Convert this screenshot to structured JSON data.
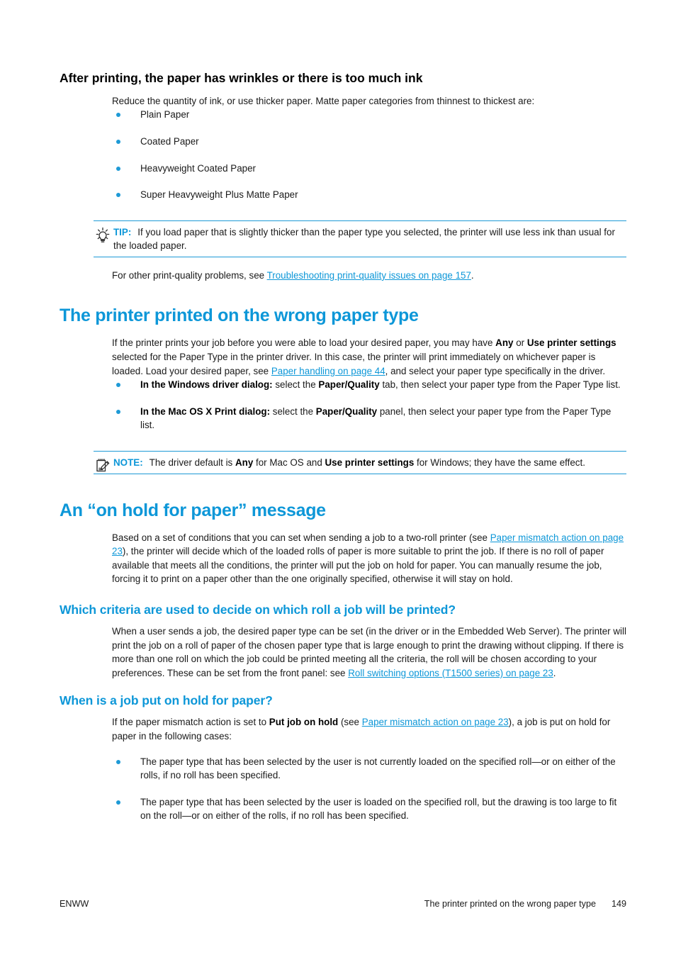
{
  "document": {
    "accent_color": "#0d97d8",
    "bullet_color": "#1e9ad6",
    "text_color": "#1a1a1a"
  },
  "section1": {
    "heading": "After printing, the paper has wrinkles or there is too much ink",
    "intro": "Reduce the quantity of ink, or use thicker paper. Matte paper categories from thinnest to thickest are:",
    "paper_types": [
      "Plain Paper",
      "Coated Paper",
      "Heavyweight Coated Paper",
      "Super Heavyweight Plus Matte Paper"
    ],
    "tip": {
      "icon": "lightbulb-icon",
      "label": "TIP:",
      "text": "If you load paper that is slightly thicker than the paper type you selected, the printer will use less ink than usual for the loaded paper."
    },
    "closing_prefix": "For other print-quality problems, see ",
    "closing_link": "Troubleshooting print-quality issues on page 157",
    "closing_suffix": "."
  },
  "section2": {
    "heading": "The printer printed on the wrong paper type",
    "para1": {
      "t1": "If the printer prints your job before you were able to load your desired paper, you may have ",
      "b1": "Any",
      "t2": " or ",
      "b2": "Use printer settings",
      "t3": " selected for the Paper Type in the printer driver. In this case, the printer will print immediately on whichever paper is loaded. Load your desired paper, see ",
      "link": "Paper handling on page 44",
      "t4": ", and select your paper type specifically in the driver."
    },
    "bullets": [
      {
        "b1": "In the Windows driver dialog:",
        "t1": " select the ",
        "b2": "Paper/Quality",
        "t2": " tab, then select your paper type from the Paper Type list."
      },
      {
        "b1": "In the Mac OS X Print dialog:",
        "t1": " select the ",
        "b2": "Paper/Quality",
        "t2": " panel, then select your paper type from the Paper Type list."
      }
    ],
    "note": {
      "icon": "notepad-pencil-icon",
      "label": "NOTE:",
      "t1": "The driver default is ",
      "b1": "Any",
      "t2": " for Mac OS and ",
      "b2": "Use printer settings",
      "t3": " for Windows; they have the same effect."
    }
  },
  "section3": {
    "heading": "An “on hold for paper” message",
    "para1": {
      "t1": "Based on a set of conditions that you can set when sending a job to a two-roll printer (see ",
      "link": "Paper mismatch action on page 23",
      "t2": "), the printer will decide which of the loaded rolls of paper is more suitable to print the job. If there is no roll of paper available that meets all the conditions, the printer will put the job on hold for paper. You can manually resume the job, forcing it to print on a paper other than the one originally specified, otherwise it will stay on hold."
    },
    "sub1": {
      "heading": "Which criteria are used to decide on which roll a job will be printed?",
      "t1": "When a user sends a job, the desired paper type can be set (in the driver or in the Embedded Web Server). The printer will print the job on a roll of paper of the chosen paper type that is large enough to print the drawing without clipping. If there is more than one roll on which the job could be printed meeting all the criteria, the roll will be chosen according to your preferences. These can be set from the front panel: see ",
      "link": "Roll switching options (T1500 series) on page 23",
      "t2": "."
    },
    "sub2": {
      "heading": "When is a job put on hold for paper?",
      "t1": "If the paper mismatch action is set to ",
      "b1": "Put job on hold",
      "t2": " (see ",
      "link": "Paper mismatch action on page 23",
      "t3": "), a job is put on hold for paper in the following cases:",
      "bullets": [
        "The paper type that has been selected by the user is not currently loaded on the specified roll—or on either of the rolls, if no roll has been specified.",
        "The paper type that has been selected by the user is loaded on the specified roll, but the drawing is too large to fit on the roll—or on either of the rolls, if no roll has been specified."
      ]
    }
  },
  "footer": {
    "left": "ENWW",
    "title": "The printer printed on the wrong paper type",
    "page_number": "149"
  }
}
